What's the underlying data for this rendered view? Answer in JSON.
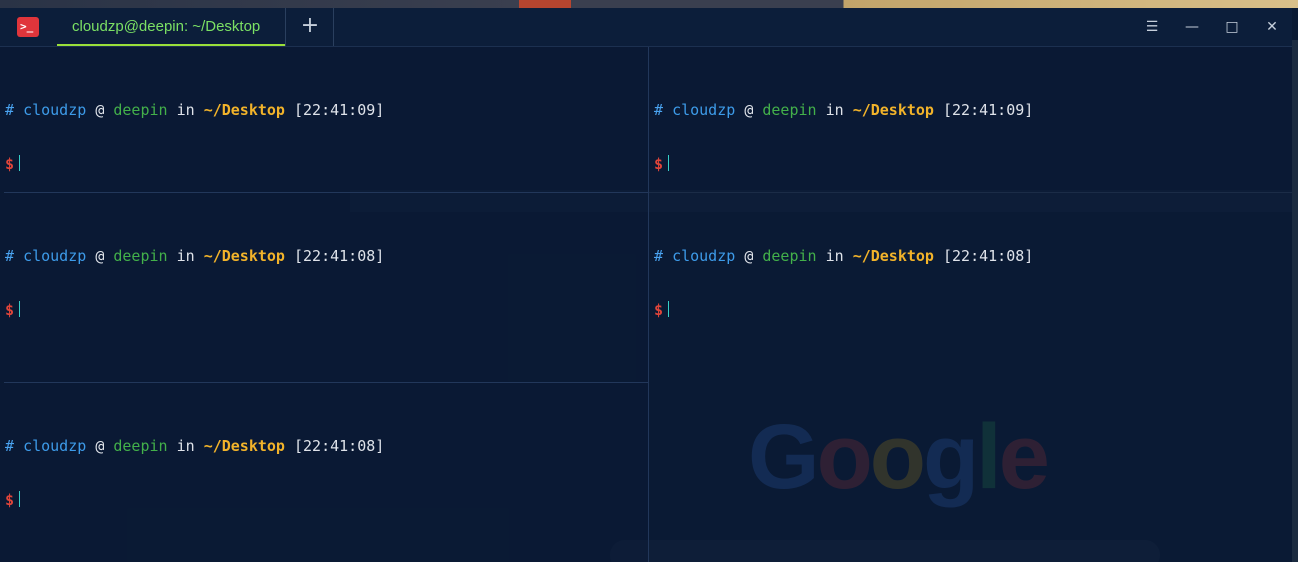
{
  "window": {
    "app_icon": "terminal-icon",
    "tab_title": "cloudzp@deepin: ~/Desktop",
    "add_tab_label": "+",
    "menu_label": "☰",
    "minimize_label": "—",
    "maximize_label": "□",
    "close_label": "✕"
  },
  "prompt": {
    "hash": "#",
    "user": "cloudzp",
    "at": "@",
    "host": "deepin",
    "in": "in",
    "dir": "~/Desktop",
    "dollar": "$"
  },
  "panes": [
    {
      "id": "top-left",
      "time": "[22:41:09]"
    },
    {
      "id": "middle-left",
      "time": "[22:41:08]"
    },
    {
      "id": "bottom-left",
      "time": "[22:41:08]"
    },
    {
      "id": "top-right",
      "time": "[22:41:09]"
    },
    {
      "id": "bottom-right",
      "time": "[22:41:08]"
    }
  ],
  "background": {
    "google_logo": "Google"
  },
  "colors": {
    "terminal_bg": "#0a1a33",
    "tab_active": "#7be064",
    "user": "#3d9be9",
    "host": "#43b04a",
    "dir": "#f2b32a",
    "dollar": "#e0453a",
    "cursor": "#35d0c8"
  }
}
